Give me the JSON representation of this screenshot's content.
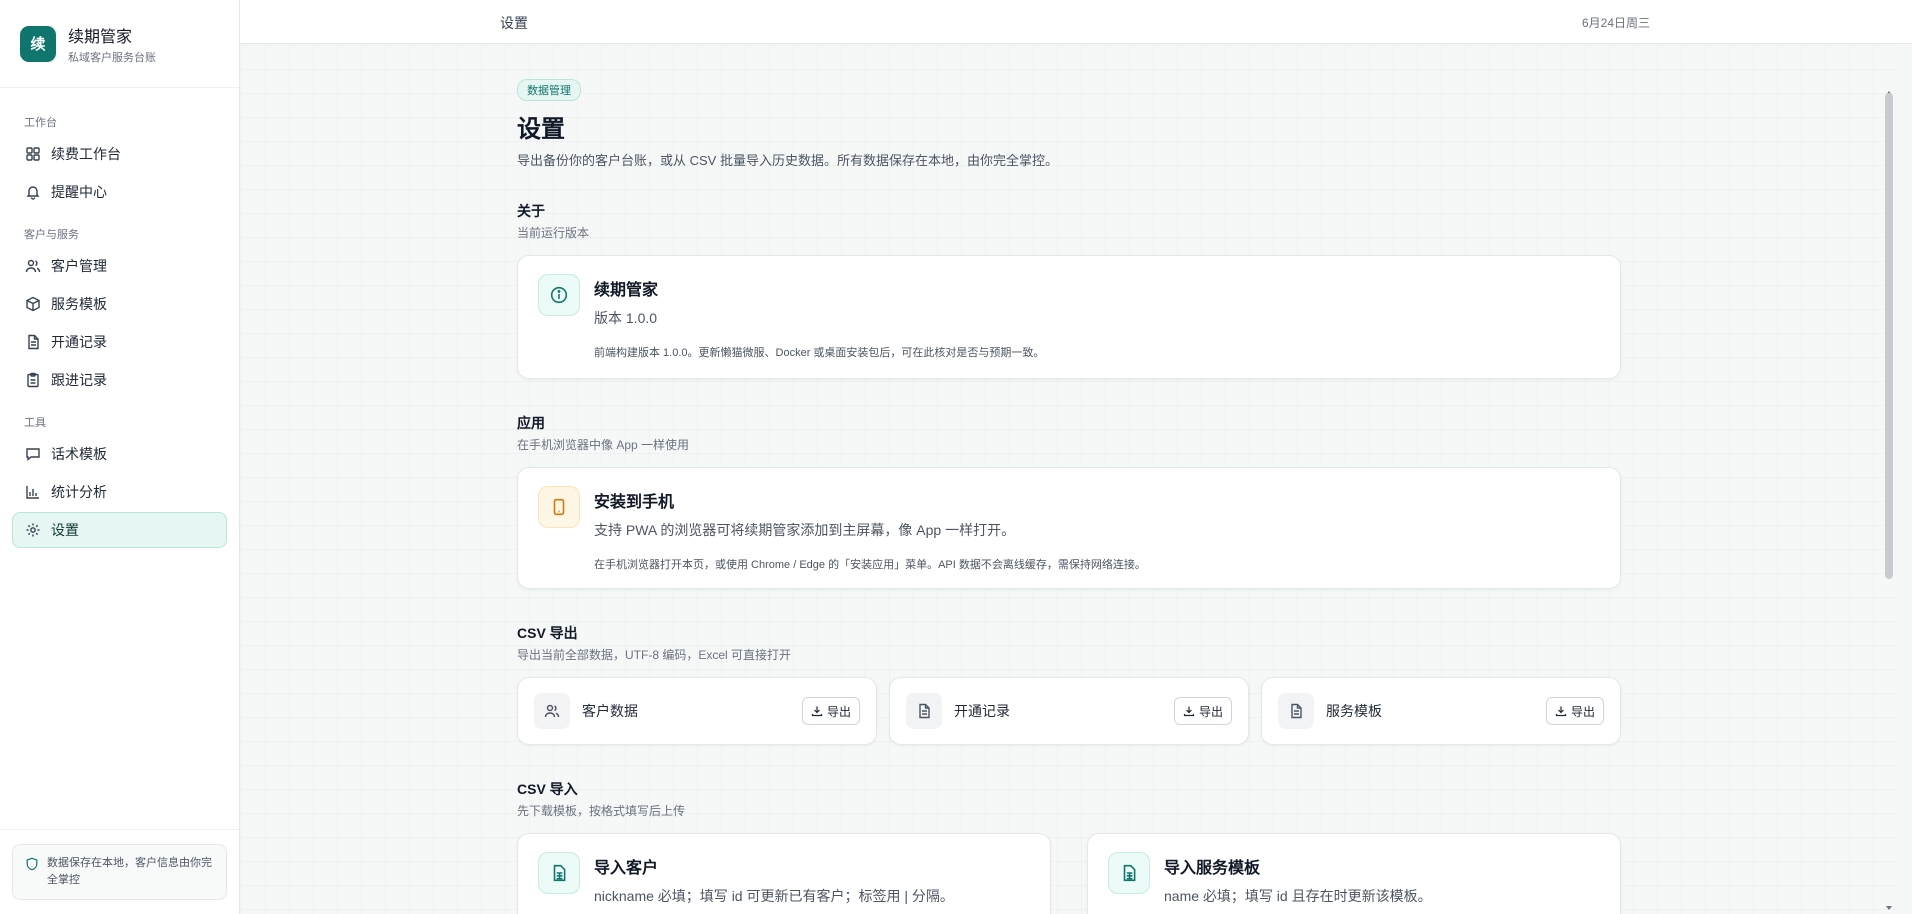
{
  "brand": {
    "logo_char": "续",
    "name": "续期管家",
    "subtitle": "私域客户服务台账"
  },
  "nav": {
    "sections": [
      {
        "label": "工作台",
        "items": [
          {
            "label": "续费工作台",
            "icon": "dashboard-icon"
          },
          {
            "label": "提醒中心",
            "icon": "bell-icon"
          }
        ]
      },
      {
        "label": "客户与服务",
        "items": [
          {
            "label": "客户管理",
            "icon": "users-icon"
          },
          {
            "label": "服务模板",
            "icon": "box-icon"
          },
          {
            "label": "开通记录",
            "icon": "document-icon"
          },
          {
            "label": "跟进记录",
            "icon": "clipboard-icon"
          }
        ]
      },
      {
        "label": "工具",
        "items": [
          {
            "label": "话术模板",
            "icon": "message-icon"
          },
          {
            "label": "统计分析",
            "icon": "bar-chart-icon"
          },
          {
            "label": "设置",
            "icon": "gear-icon",
            "active": true
          }
        ]
      }
    ],
    "footer_text": "数据保存在本地，客户信息由你完全掌控"
  },
  "topbar": {
    "title": "设置",
    "date": "6月24日周三"
  },
  "page": {
    "tag": "数据管理",
    "title": "设置",
    "description": "导出备份你的客户台账，或从 CSV 批量导入历史数据。所有数据保存在本地，由你完全掌控。"
  },
  "about": {
    "title": "关于",
    "subtitle": "当前运行版本",
    "card_title": "续期管家",
    "card_version": "版本 1.0.0",
    "card_note": "前端构建版本 1.0.0。更新懒猫微服、Docker 或桌面安装包后，可在此核对是否与预期一致。"
  },
  "app": {
    "title": "应用",
    "subtitle": "在手机浏览器中像 App 一样使用",
    "card_title": "安装到手机",
    "card_desc": "支持 PWA 的浏览器可将续期管家添加到主屏幕，像 App 一样打开。",
    "card_note": "在手机浏览器打开本页，或使用 Chrome / Edge 的「安装应用」菜单。API 数据不会离线缓存，需保持网络连接。"
  },
  "csv_export": {
    "title": "CSV 导出",
    "subtitle": "导出当前全部数据，UTF-8 编码，Excel 可直接打开",
    "button_label": "导出",
    "items": [
      {
        "label": "客户数据",
        "icon": "users-icon"
      },
      {
        "label": "开通记录",
        "icon": "document-icon"
      },
      {
        "label": "服务模板",
        "icon": "document-icon"
      }
    ]
  },
  "csv_import": {
    "title": "CSV 导入",
    "subtitle": "先下载模板，按格式填写后上传",
    "items": [
      {
        "title": "导入客户",
        "desc": "nickname 必填；填写 id 可更新已有客户；标签用 | 分隔。"
      },
      {
        "title": "导入服务模板",
        "desc": "name 必填；填写 id 且存在时更新该模板。"
      }
    ]
  },
  "colors": {
    "accent": "#0f766e",
    "accent_light": "#e6f6f2",
    "amber": "#d97706"
  }
}
